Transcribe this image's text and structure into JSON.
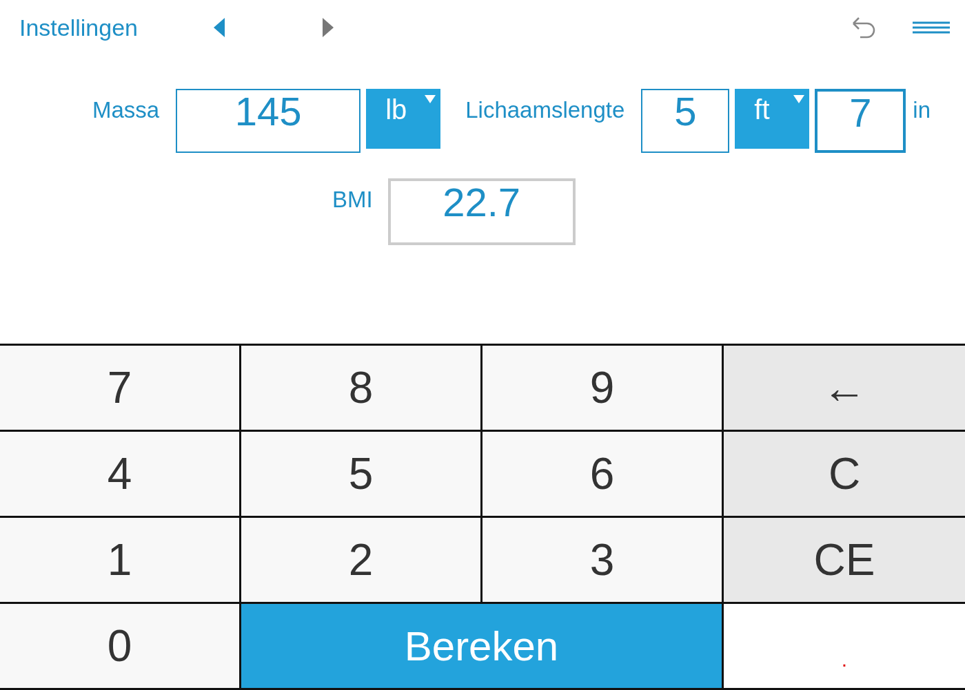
{
  "header": {
    "settings_link": "Instellingen"
  },
  "mass": {
    "label": "Massa",
    "value": "145",
    "focused": false,
    "unit": "lb"
  },
  "height": {
    "label": "Lichaamslengte",
    "feet": {
      "value": "5",
      "focused": false
    },
    "unit": "ft",
    "inches": {
      "value": "7",
      "focused": true
    },
    "inches_unit": "in"
  },
  "bmi": {
    "label": "BMI",
    "value": "22.7"
  },
  "keypad": [
    {
      "label": "7",
      "kind": "digit"
    },
    {
      "label": "8",
      "kind": "digit"
    },
    {
      "label": "9",
      "kind": "digit"
    },
    {
      "label": "←",
      "kind": "function"
    },
    {
      "label": "4",
      "kind": "digit"
    },
    {
      "label": "5",
      "kind": "digit"
    },
    {
      "label": "6",
      "kind": "digit"
    },
    {
      "label": "C",
      "kind": "function"
    },
    {
      "label": "1",
      "kind": "digit"
    },
    {
      "label": "2",
      "kind": "digit"
    },
    {
      "label": "3",
      "kind": "digit"
    },
    {
      "label": "CE",
      "kind": "function"
    },
    {
      "label": "0",
      "kind": "digit"
    },
    {
      "label": "Bereken",
      "kind": "primary"
    },
    {
      "label": ".",
      "kind": "decimal"
    }
  ]
}
